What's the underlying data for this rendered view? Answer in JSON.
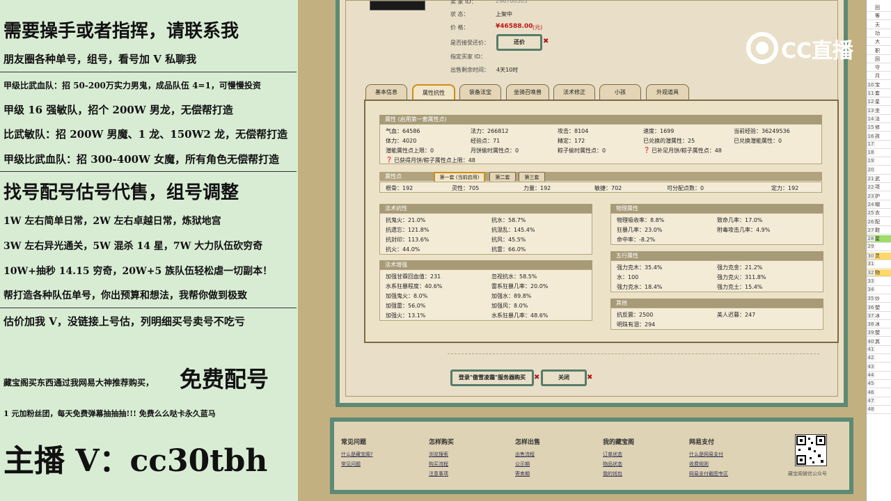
{
  "left_overlay": {
    "lines": [
      "需要操手或者指挥，请联系我",
      "朋友圈各种单号，组号，看号加 V 私聊我",
      "甲级比武血队：招 50-200万实力男鬼，成品队伍 4=1，可慢慢投资",
      "甲级 16 强敏队，招个 200W 男龙，无偿帮打造",
      "比武敏队：招 200W 男魔、1 龙、150W2 龙，无偿帮打造",
      "甲级比武血队：招 300-400W 女魔，所有角色无偿帮打造",
      "找号配号估号代售，组号调整",
      "1W 左右简单日常，2W 左右卓越日常，炼狱地宫",
      "3W 左右异光通关，5W 混杀 14 星，7W 大力队伍砍穷奇",
      "10W+抽秒 14.15 穷奇，20W+5 族队伍轻松虐一切副本！",
      "帮打造各种队伍单号，你出预算和想法，我帮你做到极致",
      "估价加我 V，没链接上号估，列明细买号卖号不吃亏",
      "藏宝阁买东西通过我网易大神推荐购买，",
      "免费配号",
      "1 元加粉丝团，每天免费弹幕抽抽抽!!! 免费么么哒卡永久蓝马",
      "主播 V：cc30tbh"
    ]
  },
  "listing": {
    "seller_label": "卖  家  ID：",
    "seller_value": "296700505",
    "status_label": "状        态：",
    "status_value": "上架中",
    "price_label": "价        格：",
    "price_value": "¥46588.00",
    "price_unit": "(元)",
    "counter_label": "是否接受还价：",
    "counter_button": "还价",
    "buyer_label": "指定买家 ID：",
    "time_label": "出售剩余时间：",
    "time_value": "4天10时"
  },
  "tabs": [
    "基本信息",
    "属性抗性",
    "装备法宝",
    "坐骑召唤兽",
    "法术修正",
    "小孩",
    "外观道具"
  ],
  "attr": {
    "header": "属性 (启用第一套属性点)",
    "rows": [
      [
        "气血：64586",
        "法力：266812",
        "攻击：8104",
        "速度：1699",
        "当前经验：36249536"
      ],
      [
        "体力：4020",
        "经验点：71",
        "精定：172",
        "已兑换的潜属性：25",
        "已兑换潜能属性：0"
      ],
      [
        "潜能属性点上限：0",
        "月饼偷时属性点：0",
        "粽子偷时属性点：0",
        "已补足月饼/粽子属性点：48",
        ""
      ],
      [
        "已获得月饼/粽子属性点上限：48",
        "",
        "",
        "",
        ""
      ]
    ]
  },
  "points": {
    "header": "属性点",
    "subtabs": [
      "第一套 (当前启用)",
      "第二套",
      "第三套"
    ],
    "row": [
      "根骨：192",
      "灵性：705",
      "力量：192",
      "敏捷：702",
      "可分配点数：0",
      "定力：192"
    ]
  },
  "magic_res": {
    "header": "法术抗性",
    "items": [
      "抗鬼火：21.0%",
      "抗水：58.7%",
      "抗遗忘：121.8%",
      "抗混乱：145.4%",
      "抗封印：113.6%",
      "抗风：45.5%",
      "抗火：44.0%",
      "抗雷：66.0%"
    ]
  },
  "magic_boost": {
    "header": "法术增强",
    "items": [
      "加强甘霖回血值：231",
      "忽视抗水：58.5%",
      "水系狂暴程度：40.6%",
      "雷系狂暴几率：20.0%",
      "加强鬼火：8.0%",
      "加强水：89.8%",
      "加强雷：56.0%",
      "加强风：8.0%",
      "加强火：13.1%",
      "水系狂暴几率：48.6%"
    ]
  },
  "phys": {
    "header": "物理属性",
    "items": [
      "物理吸收率：8.8%",
      "致命几率：17.0%",
      "狂暴几率：23.0%",
      "附毒攻击几率：4.9%",
      "命中率：-8.2%",
      ""
    ]
  },
  "five": {
    "header": "五行属性",
    "items": [
      "强力克木：35.4%",
      "强力克金：21.2%",
      "水：100",
      "强力克火：311.8%",
      "强力克水：18.4%",
      "强力克土：15.4%"
    ]
  },
  "other": {
    "header": "其他",
    "items": [
      "抗反震：2500",
      "美人迟暮：247",
      "明珠有泪：294",
      ""
    ]
  },
  "buttons": {
    "buy": "登录\"傲雪凌霜\"服务器购买",
    "close": "关闭"
  },
  "footer": {
    "cols": [
      {
        "title": "常见问题",
        "links": [
          "什么是藏宝阁?",
          "常见问题"
        ]
      },
      {
        "title": "怎样购买",
        "links": [
          "浏览搜索",
          "购买流程",
          "注意事项"
        ]
      },
      {
        "title": "怎样出售",
        "links": [
          "出售流程",
          "公示期",
          "寄卖期"
        ]
      },
      {
        "title": "我的藏宝阁",
        "links": [
          "订单状态",
          "物品状态",
          "我的钱包"
        ]
      },
      {
        "title": "网易支付",
        "links": [
          "什么是网易支付",
          "收费规则",
          "网易支付截图专区"
        ]
      }
    ],
    "qr_caption": "藏宝阁微信公众号"
  },
  "brand": {
    "logo_text": "CC直播"
  },
  "spreadsheet": {
    "rows": [
      [
        "",
        "回"
      ],
      [
        "",
        "等"
      ],
      [
        "",
        "天"
      ],
      [
        "",
        "功"
      ],
      [
        "",
        "大"
      ],
      [
        "",
        "职"
      ],
      [
        "",
        "回"
      ],
      [
        "",
        "守"
      ],
      [
        "",
        "月"
      ],
      [
        "10",
        "宝"
      ],
      [
        "11",
        "套"
      ],
      [
        "12",
        "星"
      ],
      [
        "13",
        "坐"
      ],
      [
        "14",
        "法"
      ],
      [
        "15",
        "修"
      ],
      [
        "16",
        "孩"
      ],
      [
        "17",
        ""
      ],
      [
        "18",
        ""
      ],
      [
        "19",
        ""
      ],
      [
        "20",
        ""
      ],
      [
        "21",
        "武"
      ],
      [
        "22",
        "项"
      ],
      [
        "23",
        "护"
      ],
      [
        "24",
        "帽"
      ],
      [
        "25",
        "衣"
      ],
      [
        "26",
        "配"
      ],
      [
        "27",
        "鞋"
      ],
      [
        "28",
        "星"
      ],
      [
        "29",
        ""
      ],
      [
        "30",
        "灵"
      ],
      [
        "31",
        ""
      ],
      [
        "32",
        "物"
      ],
      [
        "33",
        ""
      ],
      [
        "34",
        ""
      ],
      [
        "35",
        "炒"
      ],
      [
        "36",
        "塑"
      ],
      [
        "37",
        "冰"
      ],
      [
        "38",
        "冰"
      ],
      [
        "39",
        "塑"
      ],
      [
        "40",
        "其"
      ],
      [
        "41",
        ""
      ],
      [
        "42",
        ""
      ],
      [
        "43",
        ""
      ],
      [
        "44",
        ""
      ],
      [
        "45",
        ""
      ],
      [
        "46",
        ""
      ],
      [
        "47",
        ""
      ],
      [
        "48",
        ""
      ]
    ]
  },
  "colors": {
    "price": "#c41414",
    "accent_tab": "#d08c18",
    "frame": "#5c8a75",
    "overlay_bg": "#d8ecd4"
  }
}
